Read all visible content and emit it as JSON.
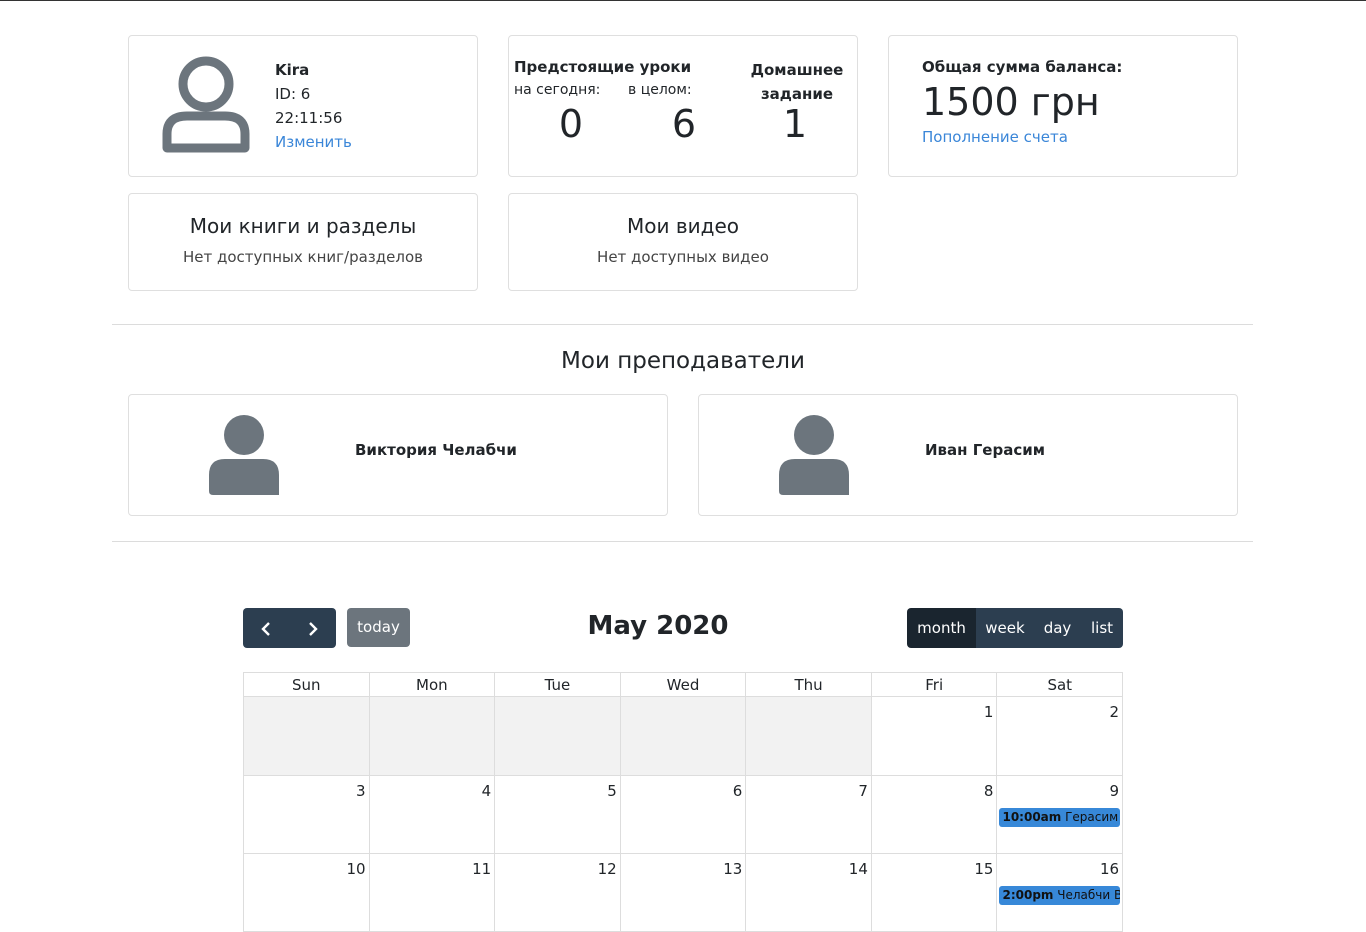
{
  "profile": {
    "name": "Kira",
    "id_line": "ID: 6",
    "time": "22:11:56",
    "edit_link": "Изменить"
  },
  "lessons": {
    "title": "Предстоящие уроки",
    "today_label": "на сегодня:",
    "total_label": "в целом:",
    "today_count": "0",
    "total_count": "6",
    "homework_title": "Домашнее задание",
    "homework_count": "1"
  },
  "balance": {
    "label": "Общая сумма баланса:",
    "value": "1500 грн",
    "topup_link": "Пополнение счета"
  },
  "books": {
    "title": "Мои книги и разделы",
    "empty": "Нет доступных книг/разделов"
  },
  "videos": {
    "title": "Мои видео",
    "empty": "Нет доступных видео"
  },
  "teachers": {
    "title": "Мои преподаватели",
    "items": [
      {
        "name": "Виктория Челабчи"
      },
      {
        "name": "Иван Герасим"
      }
    ]
  },
  "calendar": {
    "title": "May 2020",
    "today_label": "today",
    "views": [
      "month",
      "week",
      "day",
      "list"
    ],
    "active_view": "month",
    "weekdays": [
      "Sun",
      "Mon",
      "Tue",
      "Wed",
      "Thu",
      "Fri",
      "Sat"
    ],
    "weeks": [
      [
        {
          "day": "",
          "other": true
        },
        {
          "day": "",
          "other": true
        },
        {
          "day": "",
          "other": true
        },
        {
          "day": "",
          "other": true
        },
        {
          "day": "",
          "other": true
        },
        {
          "day": "1"
        },
        {
          "day": "2"
        }
      ],
      [
        {
          "day": "3"
        },
        {
          "day": "4"
        },
        {
          "day": "5"
        },
        {
          "day": "6"
        },
        {
          "day": "7"
        },
        {
          "day": "8"
        },
        {
          "day": "9",
          "event": {
            "time": "10:00am",
            "title": "Герасим И"
          }
        }
      ],
      [
        {
          "day": "10"
        },
        {
          "day": "11"
        },
        {
          "day": "12"
        },
        {
          "day": "13"
        },
        {
          "day": "14"
        },
        {
          "day": "15"
        },
        {
          "day": "16",
          "event": {
            "time": "2:00pm",
            "title": "Челабчи В"
          }
        }
      ]
    ]
  },
  "colors": {
    "link": "#3a86d8",
    "calendar_button": "#2c3e50",
    "event": "#3788d8",
    "icon": "#6c757d"
  }
}
